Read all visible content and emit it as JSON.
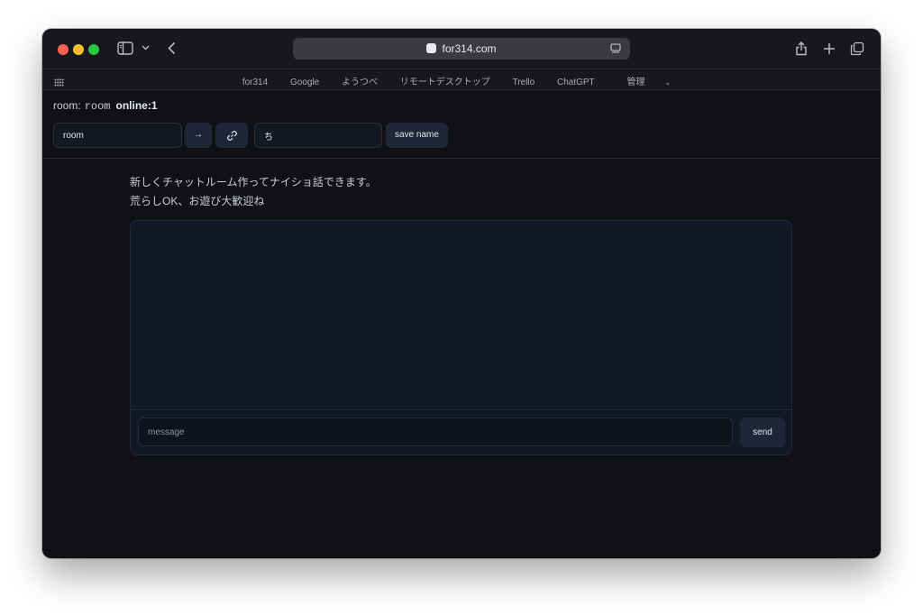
{
  "browser": {
    "url": "for314.com",
    "bookmarks": [
      "for314",
      "Google",
      "ようつべ",
      "リモートデスクトップ",
      "Trello",
      "ChatGPT",
      "管理"
    ]
  },
  "room": {
    "label": "room:",
    "name": "room",
    "online": "online:1"
  },
  "controls": {
    "room_input_value": "room",
    "go_label": "→",
    "name_input_value": "ち",
    "save_label": "save name"
  },
  "intro": {
    "line1": "新しくチャットルーム作ってナイショ話できます。",
    "line2": "荒らしOK、お遊び大歓迎ね"
  },
  "chat": {
    "message_placeholder": "message",
    "send_label": "send"
  },
  "colors": {
    "background": "#0f1115",
    "button": "#1e2638",
    "panel": "#131826"
  },
  "icons": {
    "share": "share-icon",
    "new_tab": "plus-icon",
    "tabs": "tabs-overview-icon",
    "link": "link-icon"
  }
}
